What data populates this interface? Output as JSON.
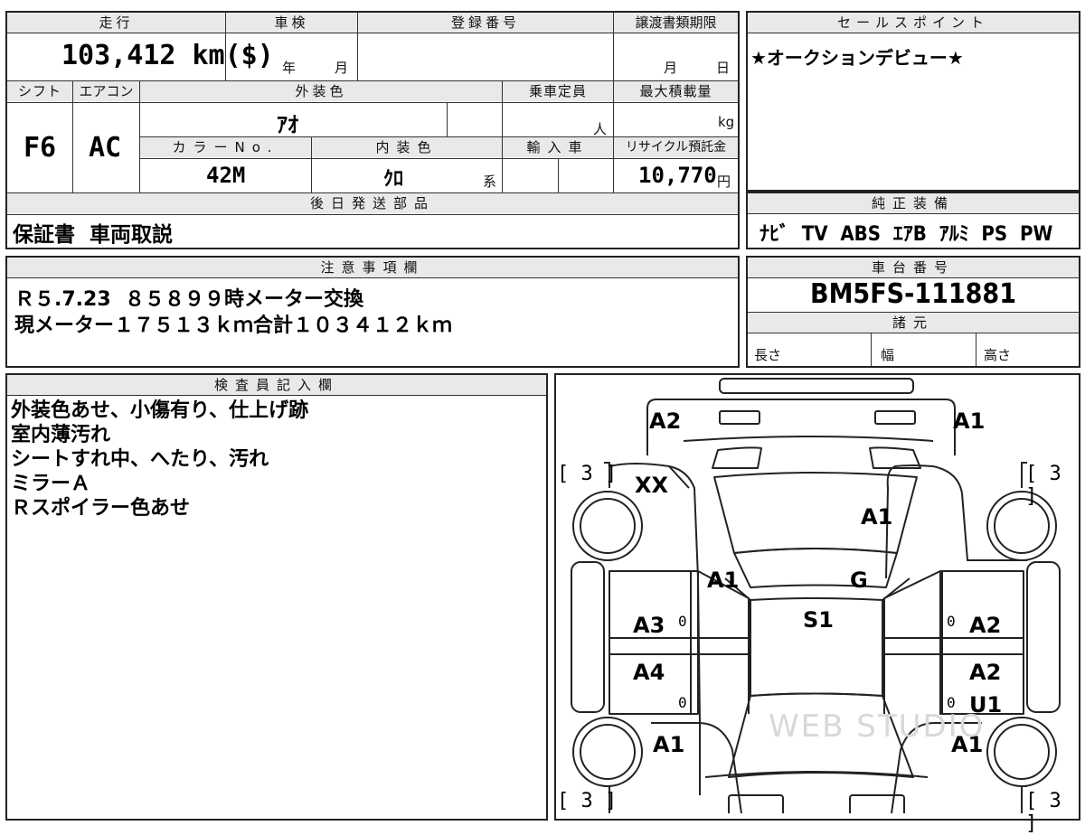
{
  "info": {
    "mileage_header": "走行",
    "inspection_header": "車検",
    "reg_header": "登録番号",
    "transfer_header": "譲渡書類期限",
    "mileage": "103,412 km($)",
    "year_unit": "年",
    "month_unit": "月",
    "transfer_month": "月",
    "transfer_day": "日",
    "shift_header": "シフト",
    "ac_header": "エアコン",
    "exterior_color_header": "外装色",
    "capacity_header": "乗車定員",
    "max_load_header": "最大積載量",
    "shift": "F6",
    "ac": "AC",
    "exterior_color": "ｱｵ",
    "capacity_unit": "人",
    "load_unit": "kg",
    "color_no_header": "カラーNo.",
    "interior_color_header": "内装色",
    "import_header": "輸入車",
    "recycle_header": "リサイクル預託金",
    "color_no": "42M",
    "interior_color": "ｸﾛ",
    "interior_suffix": "系",
    "recycle_fee": "10,770",
    "yen": "円"
  },
  "sales": {
    "header": "セールスポイント",
    "text": "★オークションデビュー★"
  },
  "delivery": {
    "header": "後日発送部品",
    "text": "保証書  車両取説"
  },
  "equipment": {
    "header": "純正装備",
    "text": "ﾅﾋﾞ  TV  ABS  ｴｱB  ｱﾙﾐ  PS  PW"
  },
  "notes": {
    "header": "注意事項欄",
    "line1": "Ｒ５.7.23  ８５８９９時メーター交換",
    "line2": "現メーター１７５１３ｋｍ合計１０３４１２ｋｍ"
  },
  "chassis": {
    "header": "車台番号",
    "number": "BM5FS-111881",
    "specs_header": "諸元",
    "length": "長さ",
    "width": "幅",
    "height": "高さ"
  },
  "inspector": {
    "header": "検査員記入欄",
    "lines": [
      "外装色あせ、小傷有り、仕上げ跡",
      "室内薄汚れ",
      "シートすれ中、へたり、汚れ",
      "ミラーＡ",
      "Ｒスポイラー色あせ"
    ]
  },
  "diagram": {
    "tire_bracket": "[ 3 ]",
    "zero": "0",
    "marks": {
      "front_left": "A2",
      "front_right": "A1",
      "fender_left": "XX",
      "hood": "A1",
      "pillar_left": "A1",
      "windshield": "G",
      "roof": "S1",
      "door_fl": "A3",
      "door_fr": "A2",
      "door_rl": "A4",
      "door_rr_1": "A2",
      "door_rr_2": "U1",
      "quarter_left": "A1",
      "quarter_right": "A1"
    },
    "watermark": "WEB STUDIO"
  }
}
